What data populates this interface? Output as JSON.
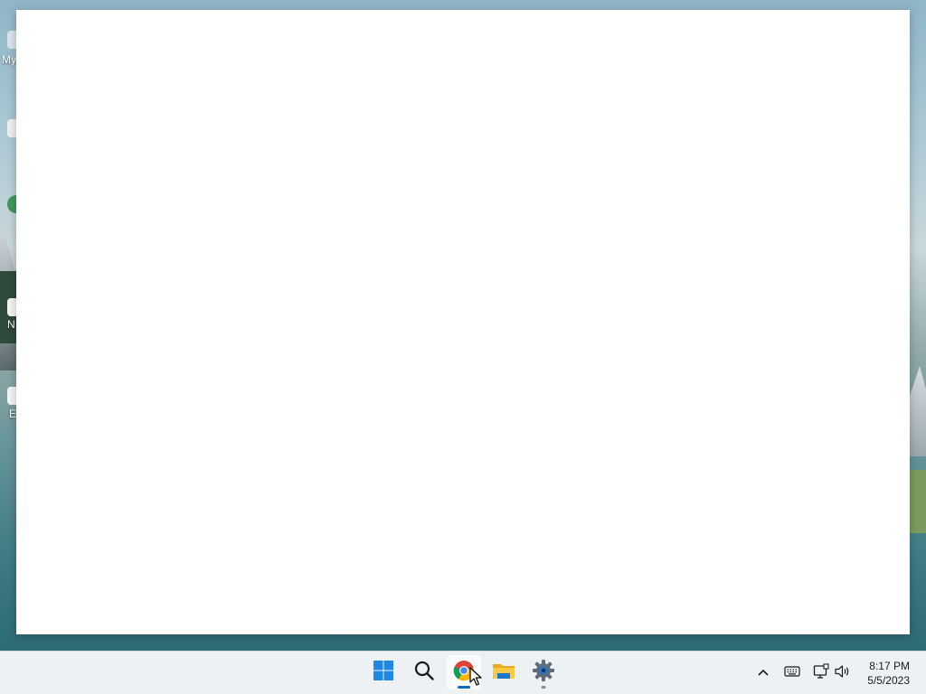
{
  "desktop": {
    "icons": [
      {
        "label": "My"
      },
      {
        "label": "N"
      },
      {
        "label": "E"
      }
    ]
  },
  "window": {
    "title": ""
  },
  "taskbar": {
    "apps": [
      {
        "name": "Start",
        "icon": "windows-logo-icon"
      },
      {
        "name": "Search",
        "icon": "search-icon"
      },
      {
        "name": "Google Chrome",
        "icon": "chrome-icon",
        "running": true,
        "active": true
      },
      {
        "name": "File Explorer",
        "icon": "folder-icon"
      },
      {
        "name": "Settings",
        "icon": "gear-icon",
        "running": true
      }
    ],
    "tray": {
      "icons": [
        "chevron-up-icon",
        "keyboard-icon",
        "network-icon",
        "volume-icon"
      ]
    },
    "clock": {
      "time": "8:17 PM",
      "date": "5/5/2023"
    }
  },
  "colors": {
    "accent": "#0a6cbd",
    "taskbar_bg": "#eef1f4",
    "window_bg": "#ffffff"
  }
}
